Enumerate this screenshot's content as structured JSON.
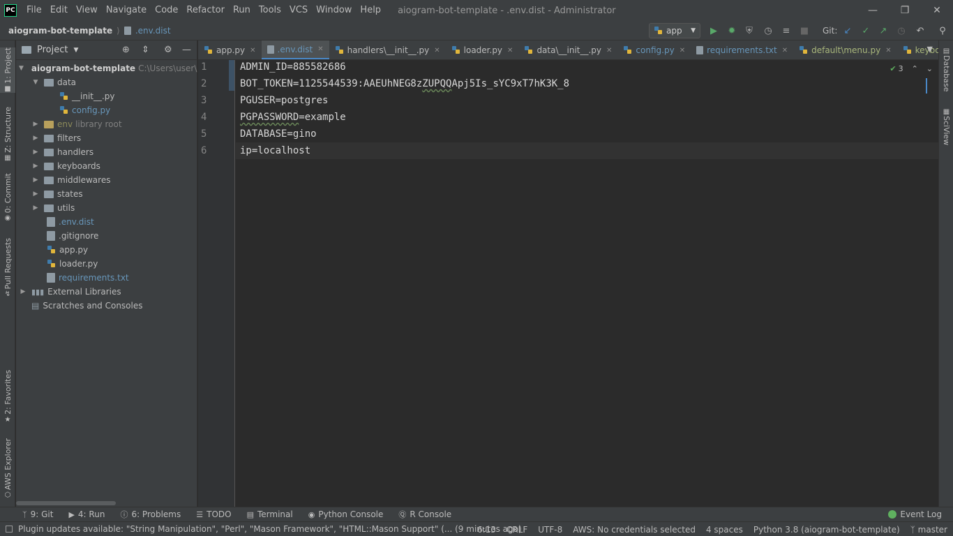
{
  "titlebar": {
    "logo": "PC",
    "menus": [
      "File",
      "Edit",
      "View",
      "Navigate",
      "Code",
      "Refactor",
      "Run",
      "Tools",
      "VCS",
      "Window",
      "Help"
    ],
    "window_title": "aiogram-bot-template - .env.dist - Administrator",
    "controls": [
      "minimize-icon",
      "restore-icon",
      "close-icon"
    ]
  },
  "navbar": {
    "project": "aiogram-bot-template",
    "file": ".env.dist",
    "run_config": "app",
    "git_label": "Git:"
  },
  "left_strip": {
    "project": "1: Project",
    "structure": "Z: Structure",
    "commit": "0: Commit",
    "pull_requests": "Pull Requests",
    "favorites": "2: Favorites",
    "aws": "AWS Explorer"
  },
  "right_strip": {
    "database": "Database",
    "sciview": "SciView"
  },
  "project_panel": {
    "title": "Project",
    "root": "aiogram-bot-template",
    "root_path": "C:\\Users\\user\\Py",
    "tree": {
      "data": "data",
      "init": "__init__.py",
      "config": "config.py",
      "env": "env",
      "env_note": "library root",
      "filters": "filters",
      "handlers": "handlers",
      "keyboards": "keyboards",
      "middlewares": "middlewares",
      "states": "states",
      "utils": "utils",
      "envdist": ".env.dist",
      "gitignore": ".gitignore",
      "app": "app.py",
      "loader": "loader.py",
      "requirements": "requirements.txt",
      "external": "External Libraries",
      "scratches": "Scratches and Consoles"
    }
  },
  "tabs": [
    {
      "label": "app.py"
    },
    {
      "label": ".env.dist"
    },
    {
      "label": "handlers\\__init__.py"
    },
    {
      "label": "loader.py"
    },
    {
      "label": "data\\__init__.py"
    },
    {
      "label": "config.py"
    },
    {
      "label": "requirements.txt"
    },
    {
      "label": "default\\menu.py"
    },
    {
      "label": "keyboards\\_"
    }
  ],
  "editor": {
    "line_numbers": [
      "1",
      "2",
      "3",
      "4",
      "5",
      "6"
    ],
    "lines": {
      "l1": "ADMIN_ID=885582686",
      "l2a": "BOT_TOKEN=1125544539:AAEUhNEG8z",
      "l2b": "ZUPQQ",
      "l2c": "Apj5Is_sYC9xT7hK3K_8",
      "l3": "PGUSER=postgres",
      "l4a": "PGPASSWORD",
      "l4b": "=example",
      "l5": "DATABASE=gino",
      "l6": "ip=localhost"
    },
    "inspection_count": "3"
  },
  "bottom_tools": {
    "git": "9: Git",
    "run": "4: Run",
    "problems": "6: Problems",
    "todo": "TODO",
    "terminal": "Terminal",
    "python_console": "Python Console",
    "r_console": "R Console",
    "event_log": "Event Log"
  },
  "statusbar": {
    "message": "Plugin updates available: \"String Manipulation\", \"Perl\", \"Mason Framework\", \"HTML::Mason Support\" (... (9 minutes ago)",
    "position": "6:13",
    "line_sep": "CRLF",
    "encoding": "UTF-8",
    "aws": "AWS: No credentials selected",
    "indent": "4 spaces",
    "interpreter": "Python 3.8 (aiogram-bot-template)",
    "branch": "master"
  }
}
